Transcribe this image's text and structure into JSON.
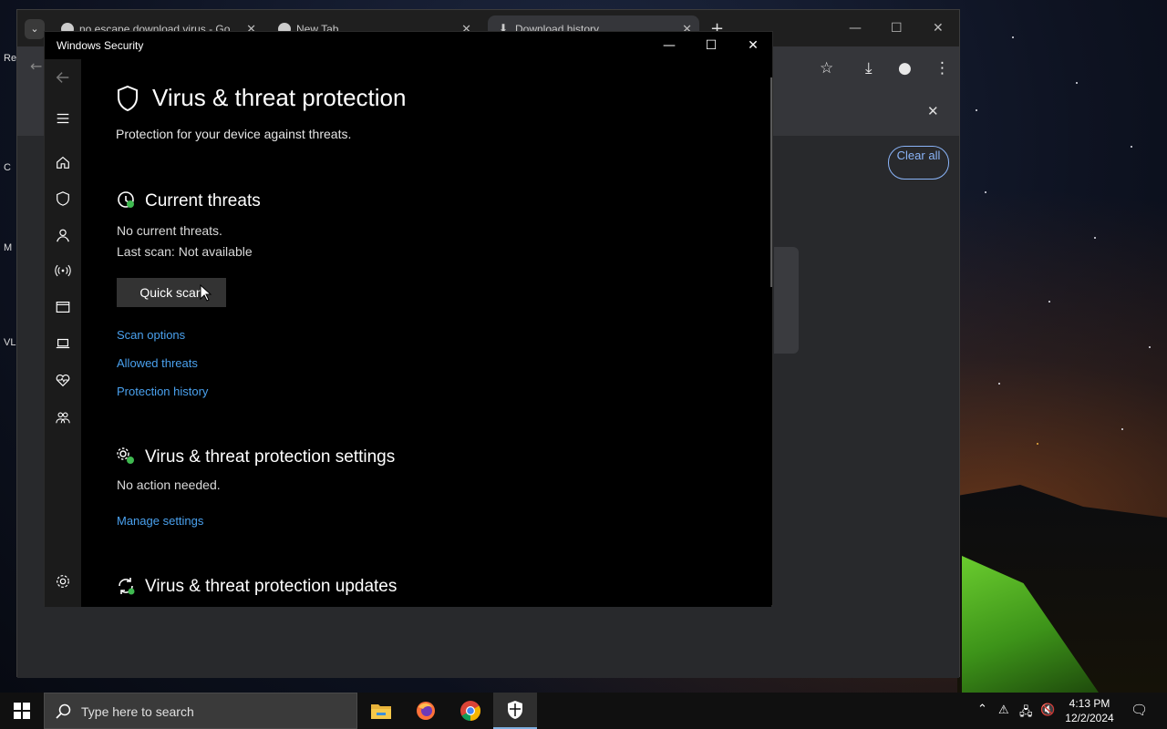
{
  "browser": {
    "tabs": [
      {
        "label": "no escape download virus - Go"
      },
      {
        "label": "New Tab"
      },
      {
        "label": "Download history"
      }
    ],
    "clear_all_label": "Clear all"
  },
  "desktop_icons": [
    "Re",
    "C",
    "M",
    "VL"
  ],
  "security_window": {
    "title": "Windows Security",
    "page_title": "Virus & threat protection",
    "subtitle": "Protection for your device against threats.",
    "current_threats": {
      "heading": "Current threats",
      "status": "No current threats.",
      "last_scan": "Last scan: Not available",
      "quick_scan_label": "Quick scan",
      "links": [
        "Scan options",
        "Allowed threats",
        "Protection history"
      ]
    },
    "settings": {
      "heading": "Virus & threat protection settings",
      "status": "No action needed.",
      "link": "Manage settings"
    },
    "updates": {
      "heading": "Virus & threat protection updates"
    },
    "nav_items": [
      "hamburger-menu",
      "home",
      "virus-protection",
      "account-protection",
      "firewall-network",
      "app-browser-control",
      "device-security",
      "device-performance",
      "family-options",
      "settings"
    ]
  },
  "taskbar": {
    "search_placeholder": "Type here to search",
    "time": "4:13 PM",
    "date": "12/2/2024",
    "apps": [
      "file-explorer",
      "firefox",
      "chrome",
      "windows-security"
    ]
  },
  "colors": {
    "accent_link": "#4aa1ee",
    "chrome_link": "#8ab4f8",
    "status_green": "#3fb950"
  }
}
